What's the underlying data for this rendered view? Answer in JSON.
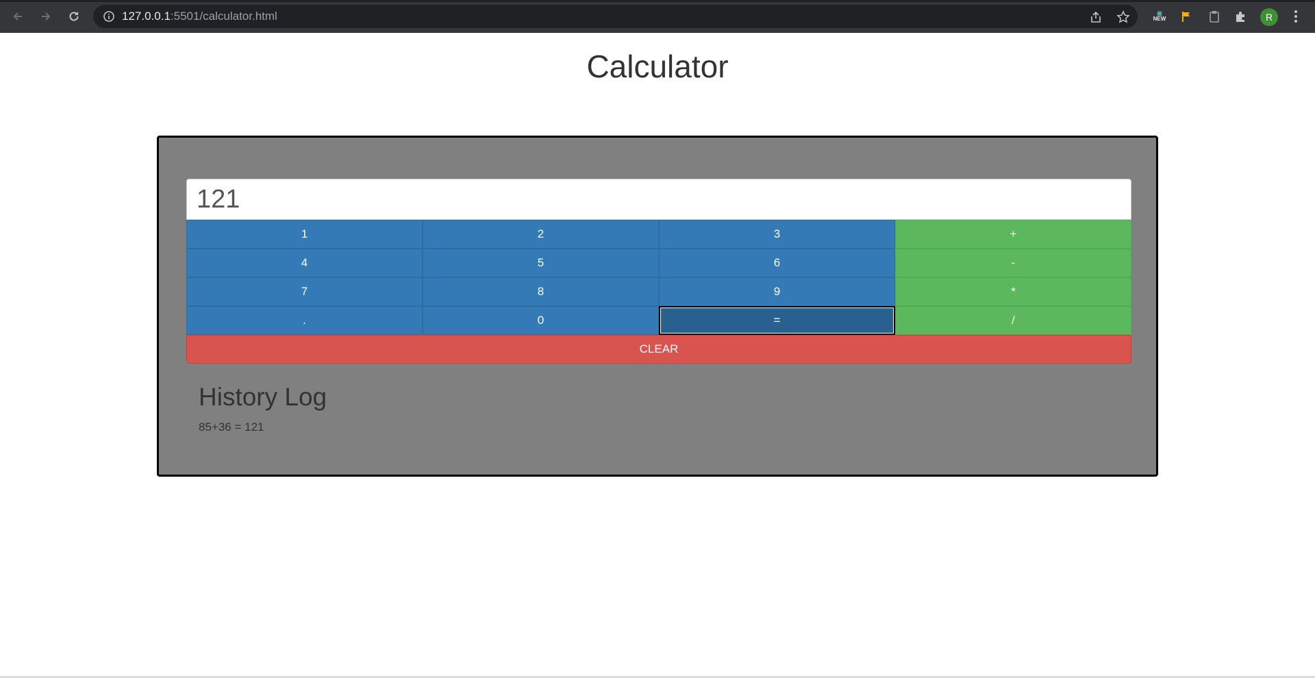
{
  "browser": {
    "url_host": "127.0.0.1",
    "url_path": ":5501/calculator.html",
    "ext_new_badge": "NEW",
    "avatar_letter": "R"
  },
  "page": {
    "title": "Calculator"
  },
  "calculator": {
    "display_value": "121",
    "keys": [
      {
        "label": "1",
        "kind": "num"
      },
      {
        "label": "2",
        "kind": "num"
      },
      {
        "label": "3",
        "kind": "num"
      },
      {
        "label": "+",
        "kind": "op"
      },
      {
        "label": "4",
        "kind": "num"
      },
      {
        "label": "5",
        "kind": "num"
      },
      {
        "label": "6",
        "kind": "num"
      },
      {
        "label": "-",
        "kind": "op"
      },
      {
        "label": "7",
        "kind": "num"
      },
      {
        "label": "8",
        "kind": "num"
      },
      {
        "label": "9",
        "kind": "num"
      },
      {
        "label": "*",
        "kind": "op"
      },
      {
        "label": ".",
        "kind": "num"
      },
      {
        "label": "0",
        "kind": "num"
      },
      {
        "label": "=",
        "kind": "num"
      },
      {
        "label": "/",
        "kind": "op"
      }
    ],
    "clear_label": "CLEAR"
  },
  "history": {
    "title": "History Log",
    "entries": [
      "85+36 = 121"
    ]
  },
  "colors": {
    "number_key": "#337ab7",
    "operator_key": "#5cb85c",
    "clear_key": "#d9534f",
    "panel": "#808080"
  }
}
